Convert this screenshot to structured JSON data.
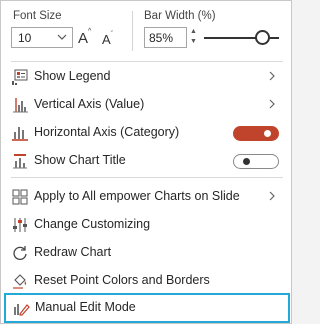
{
  "header": {
    "font_size_label": "Font Size",
    "font_size_value": "10",
    "increase_font": "A",
    "decrease_font": "A",
    "bar_width_label": "Bar Width (%)",
    "bar_width_value": "85%",
    "bar_width_level_percent": 85
  },
  "items": {
    "show_legend": "Show Legend",
    "vertical_axis": "Vertical Axis (Value)",
    "horizontal_axis": "Horizontal Axis (Category)",
    "show_chart_title": "Show Chart Title",
    "apply_all": "Apply to All empower Charts on Slide",
    "change_customizing": "Change Customizing",
    "redraw_chart": "Redraw Chart",
    "reset_point_colors": "Reset Point Colors and Borders",
    "manual_edit_mode": "Manual Edit Mode"
  },
  "toggles": {
    "horizontal_axis_on": true,
    "show_chart_title_on": false
  },
  "colors": {
    "toggle_on": "#c0432b",
    "highlight_border": "#22a9d9",
    "icon_red": "#c0432b"
  }
}
